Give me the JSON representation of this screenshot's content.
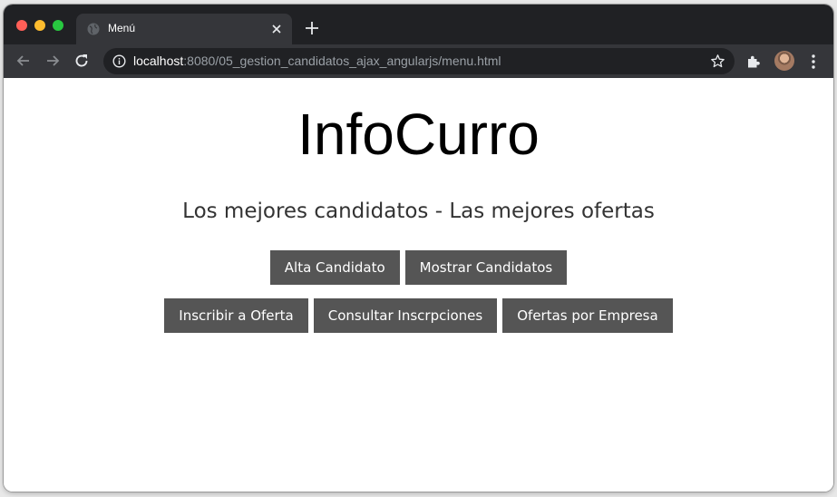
{
  "browser": {
    "tab_title": "Menú",
    "url_host": "localhost",
    "url_rest": ":8080/05_gestion_candidatos_ajax_angularjs/menu.html"
  },
  "page": {
    "title": "InfoCurro",
    "subtitle": "Los mejores candidatos - Las mejores ofertas",
    "buttons_row1": [
      {
        "label": "Alta Candidato"
      },
      {
        "label": "Mostrar Candidatos"
      }
    ],
    "buttons_row2": [
      {
        "label": "Inscribir a Oferta"
      },
      {
        "label": "Consultar Inscrpciones"
      },
      {
        "label": "Ofertas por Empresa"
      }
    ]
  },
  "colors": {
    "button_bg": "#555555",
    "button_text": "#ffffff",
    "chrome_dark": "#202124",
    "chrome_mid": "#35363a"
  }
}
